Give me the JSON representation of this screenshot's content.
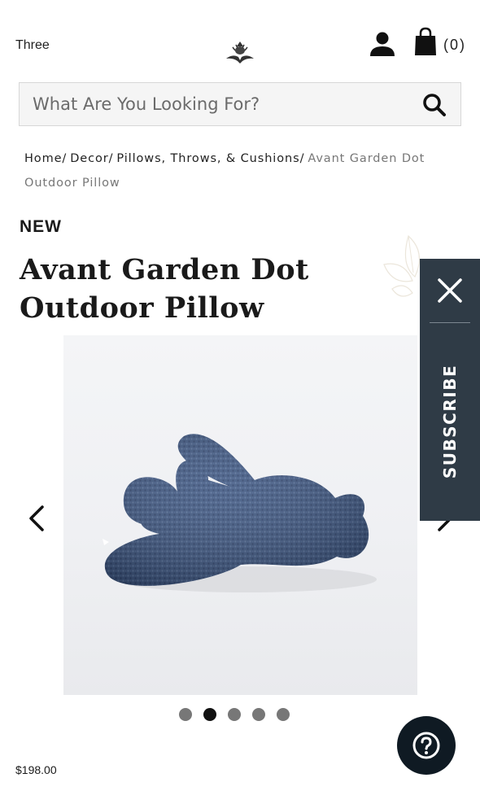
{
  "header": {
    "brand_text": "Three",
    "logo_icon": "thistle-crest-icon",
    "account_icon": "person-icon",
    "cart_icon": "shopping-bag-icon",
    "cart_count": "(0)"
  },
  "search": {
    "placeholder": "What Are You Looking For?",
    "value": "",
    "icon": "search-icon"
  },
  "breadcrumb": {
    "items": [
      "Home",
      "Decor",
      "Pillows, Throws, & Cushions"
    ],
    "current": "Avant Garden Dot Outdoor Pillow"
  },
  "product": {
    "badge": "NEW",
    "title": "Avant Garden Dot Outdoor Pillow",
    "price": "$198.00",
    "image": "navy-blue-bunny-shaped-pillow"
  },
  "gallery": {
    "dot_count": 5,
    "active_dot": 2,
    "prev_icon": "chevron-left-icon",
    "next_icon": "chevron-right-icon"
  },
  "subscribe_panel": {
    "label": "SUBSCRIBE",
    "close_icon": "close-icon"
  },
  "help": {
    "icon": "question-mark-icon"
  },
  "colors": {
    "panel_bg": "#2f3b46",
    "help_bg": "#0f1a23",
    "pillow": "#3c5580",
    "text": "#1a1a1a"
  }
}
